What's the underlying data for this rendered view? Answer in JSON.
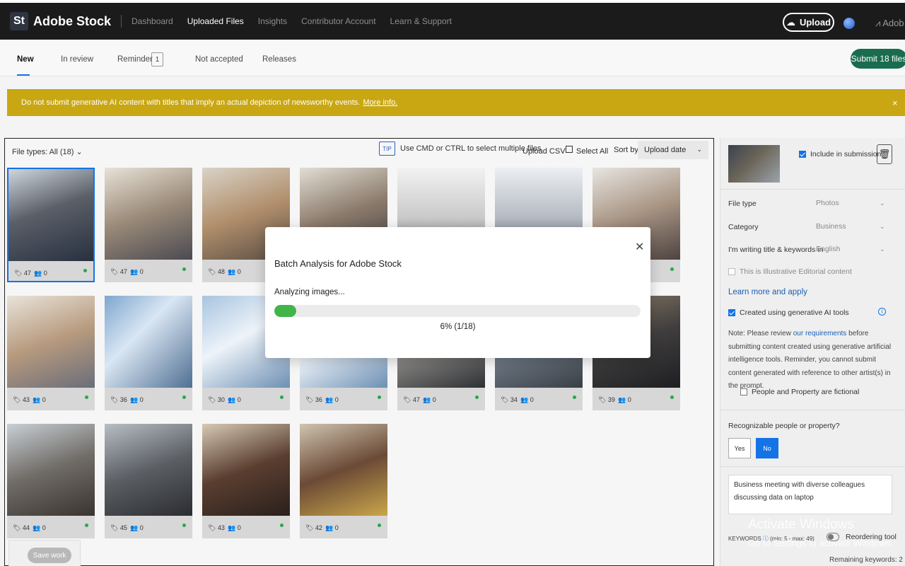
{
  "header": {
    "logo": "St",
    "brand": "Adobe Stock",
    "nav": [
      "Dashboard",
      "Uploaded Files",
      "Insights",
      "Contributor Account",
      "Learn & Support"
    ],
    "upload_label": "Upload",
    "adobe_label": "Adob"
  },
  "tabs": {
    "new": "New",
    "in_review": "In review",
    "reminder": "Reminder",
    "reminder_count": "1",
    "not_accepted": "Not accepted",
    "releases": "Releases",
    "submit_label": "Submit 18 files"
  },
  "banner": {
    "text": "Do not submit generative AI content with titles that imply an actual depiction of newsworthy events.",
    "link": "More info.",
    "close": "×"
  },
  "toolbar": {
    "file_types": "File types: All (18)",
    "tip": "TIP",
    "tip_text": "Use CMD or CTRL to select multiple files",
    "upload_csv": "Upload CSV",
    "select_all": "Select All",
    "sort_by": "Sort by",
    "sort_value": "Upload date"
  },
  "thumbnails": [
    {
      "keywords": "47",
      "people": "0"
    },
    {
      "keywords": "47",
      "people": "0"
    },
    {
      "keywords": "48",
      "people": "0"
    },
    {
      "keywords": "",
      "people": ""
    },
    {
      "keywords": "",
      "people": ""
    },
    {
      "keywords": "",
      "people": ""
    },
    {
      "keywords": "",
      "people": ""
    },
    {
      "keywords": "43",
      "people": "0"
    },
    {
      "keywords": "36",
      "people": "0"
    },
    {
      "keywords": "30",
      "people": "0"
    },
    {
      "keywords": "36",
      "people": "0"
    },
    {
      "keywords": "47",
      "people": "0"
    },
    {
      "keywords": "34",
      "people": "0"
    },
    {
      "keywords": "39",
      "people": "0"
    },
    {
      "keywords": "44",
      "people": "0"
    },
    {
      "keywords": "45",
      "people": "0"
    },
    {
      "keywords": "43",
      "people": "0"
    },
    {
      "keywords": "42",
      "people": "0"
    }
  ],
  "save_work": "Save work",
  "side": {
    "include": "Include in submission",
    "file_type_label": "File type",
    "file_type_value": "Photos",
    "category_label": "Category",
    "category_value": "Business",
    "language_label": "I'm writing title & keywords in",
    "language_value": "English",
    "editorial": "This is Illustrative Editorial content",
    "learn": "Learn more and apply",
    "gen_ai": "Created using generative AI tools",
    "note_pre": "Note: Please review",
    "note_link": "our requirements",
    "note_post": "before submitting content created using generative artificial intelligence tools. Reminder, you cannot submit content generated with reference to other artist(s) in the prompt.",
    "fictional": "People and Property are fictional",
    "recognizable": "Recognizable people or property?",
    "yes": "Yes",
    "no": "No",
    "title": "Business meeting with diverse colleagues discussing data on laptop",
    "keywords_label": "KEYWORDS",
    "keywords_range": "(min: 5 - max: 49)",
    "reorder": "Reordering tool",
    "remaining": "Remaining keywords: 2"
  },
  "watermark": {
    "line1": "Activate Windows",
    "line2": "Go to Settings to activate Windows."
  },
  "modal": {
    "title": "Batch Analysis for Adobe Stock",
    "status": "Analyzing images...",
    "progress": 0.06,
    "progress_text": "6% (1/18)"
  }
}
